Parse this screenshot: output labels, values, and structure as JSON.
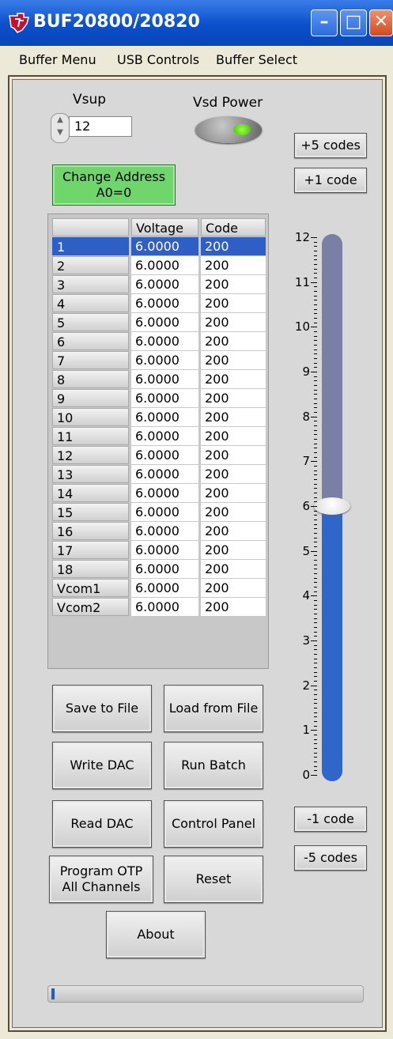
{
  "window": {
    "title": "BUF20800/20820",
    "minimize_glyph": "–",
    "maximize_glyph": "□",
    "close_glyph": "✕"
  },
  "menu": [
    "Buffer Menu",
    "USB Controls",
    "Buffer Select"
  ],
  "vsup": {
    "label": "Vsup",
    "value": "12"
  },
  "vsd_power": {
    "label": "Vsd Power",
    "on": true,
    "led_color": "#5fd61f"
  },
  "change_address": {
    "line1": "Change Address",
    "line2": "A0=0",
    "color": "#6fd66c"
  },
  "table": {
    "headers": [
      "",
      "Voltage",
      "Code"
    ],
    "rows": [
      {
        "label": "1",
        "voltage": "6.0000",
        "code": "200",
        "selected": true
      },
      {
        "label": "2",
        "voltage": "6.0000",
        "code": "200"
      },
      {
        "label": "3",
        "voltage": "6.0000",
        "code": "200"
      },
      {
        "label": "4",
        "voltage": "6.0000",
        "code": "200"
      },
      {
        "label": "5",
        "voltage": "6.0000",
        "code": "200"
      },
      {
        "label": "6",
        "voltage": "6.0000",
        "code": "200"
      },
      {
        "label": "7",
        "voltage": "6.0000",
        "code": "200"
      },
      {
        "label": "8",
        "voltage": "6.0000",
        "code": "200"
      },
      {
        "label": "9",
        "voltage": "6.0000",
        "code": "200"
      },
      {
        "label": "10",
        "voltage": "6.0000",
        "code": "200"
      },
      {
        "label": "11",
        "voltage": "6.0000",
        "code": "200"
      },
      {
        "label": "12",
        "voltage": "6.0000",
        "code": "200"
      },
      {
        "label": "13",
        "voltage": "6.0000",
        "code": "200"
      },
      {
        "label": "14",
        "voltage": "6.0000",
        "code": "200"
      },
      {
        "label": "15",
        "voltage": "6.0000",
        "code": "200"
      },
      {
        "label": "16",
        "voltage": "6.0000",
        "code": "200"
      },
      {
        "label": "17",
        "voltage": "6.0000",
        "code": "200"
      },
      {
        "label": "18",
        "voltage": "6.0000",
        "code": "200"
      },
      {
        "label": "Vcom1",
        "voltage": "6.0000",
        "code": "200"
      },
      {
        "label": "Vcom2",
        "voltage": "6.0000",
        "code": "200"
      }
    ]
  },
  "code_buttons": {
    "plus5": "+5 codes",
    "plus1": "+1 code",
    "minus1": "-1 code",
    "minus5": "-5 codes"
  },
  "slider": {
    "min": 0,
    "max": 12,
    "value": 6.0,
    "scale_labels": [
      "0",
      "1",
      "2",
      "3",
      "4",
      "5",
      "6",
      "7",
      "8",
      "9",
      "10",
      "11",
      "12"
    ],
    "fill_color": "#2e67c9",
    "track_color": "#7a7fa5"
  },
  "buttons": {
    "save": "Save to File",
    "load": "Load from File",
    "write": "Write DAC",
    "run": "Run Batch",
    "read": "Read DAC",
    "control": "Control Panel",
    "program": "Program OTP All Channels",
    "reset": "Reset",
    "about": "About"
  },
  "progress": {
    "fraction": 0.01
  }
}
